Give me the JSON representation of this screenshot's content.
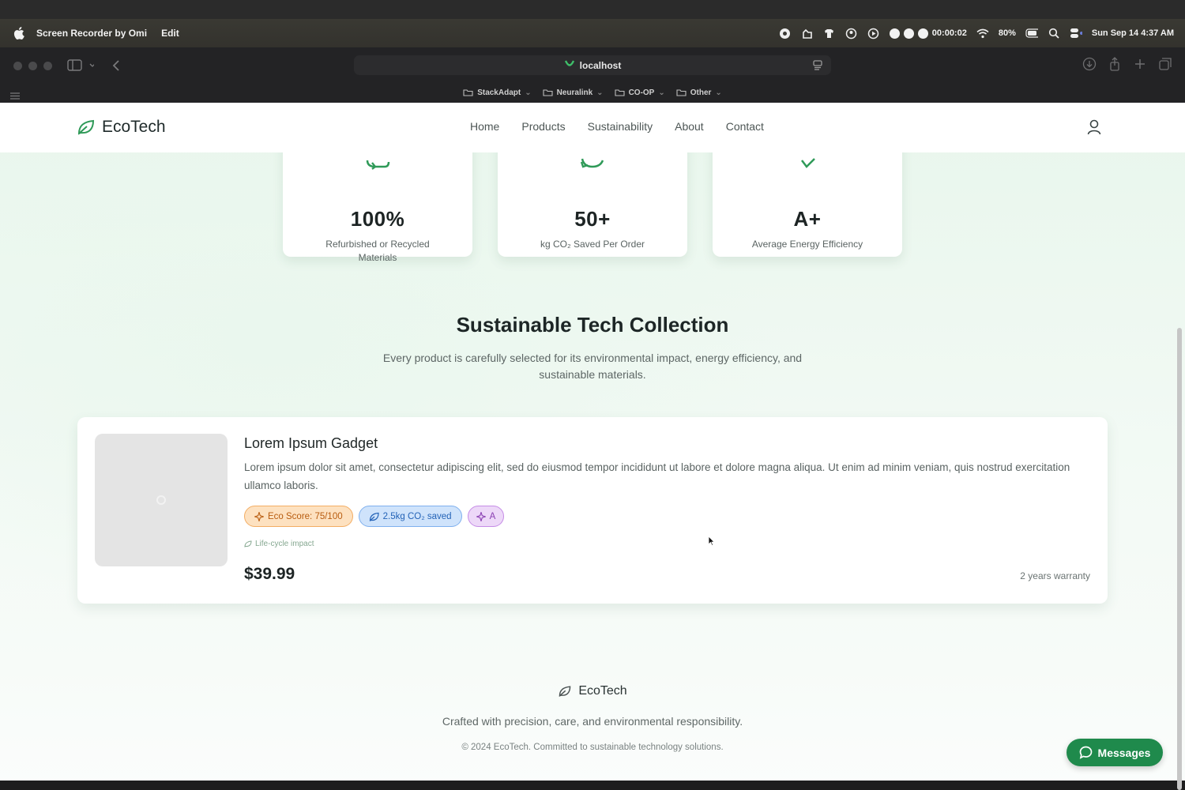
{
  "menubar": {
    "app_name": "Screen Recorder by Omi",
    "menu_edit": "Edit",
    "rec_time": "00:00:02",
    "battery": "80%",
    "datetime": "Sun Sep 14  4:37 AM"
  },
  "browser": {
    "url": "localhost",
    "bookmarks": [
      "StackAdapt",
      "Neuralink",
      "CO-OP",
      "Other"
    ]
  },
  "site": {
    "brand": "EcoTech",
    "nav": [
      "Home",
      "Products",
      "Sustainability",
      "About",
      "Contact"
    ],
    "accent_color": "#1f8a4c"
  },
  "stats": [
    {
      "value": "100%",
      "label": "Refurbished or Recycled Materials",
      "icon": "recycle-icon"
    },
    {
      "value": "50+",
      "label": "kg CO₂ Saved Per Order",
      "icon": "refresh-icon"
    },
    {
      "value": "A+",
      "label": "Average Energy Efficiency",
      "icon": "check-icon"
    }
  ],
  "collection": {
    "title": "Sustainable Tech Collection",
    "subtitle": "Every product is carefully selected for its environmental impact, energy efficiency, and sustainable materials."
  },
  "product": {
    "name": "Lorem Ipsum Gadget",
    "description": "Lorem ipsum dolor sit amet, consectetur adipiscing elit, sed do eiusmod tempor incididunt ut labore et dolore magna aliqua. Ut enim ad minim veniam, quis nostrud exercitation ullamco laboris.",
    "eco_score": "Eco Score: 75/100",
    "co2_saved": "2.5kg CO₂ saved",
    "energy_rating": "A",
    "lifecycle": "Life-cycle impact",
    "price": "$39.99",
    "warranty": "2 years warranty"
  },
  "footer": {
    "brand": "EcoTech",
    "tagline": "Crafted with precision, care, and environmental responsibility.",
    "copyright": "© 2024 EcoTech. Committed to sustainable technology solutions."
  },
  "chat": {
    "label": "Messages"
  }
}
